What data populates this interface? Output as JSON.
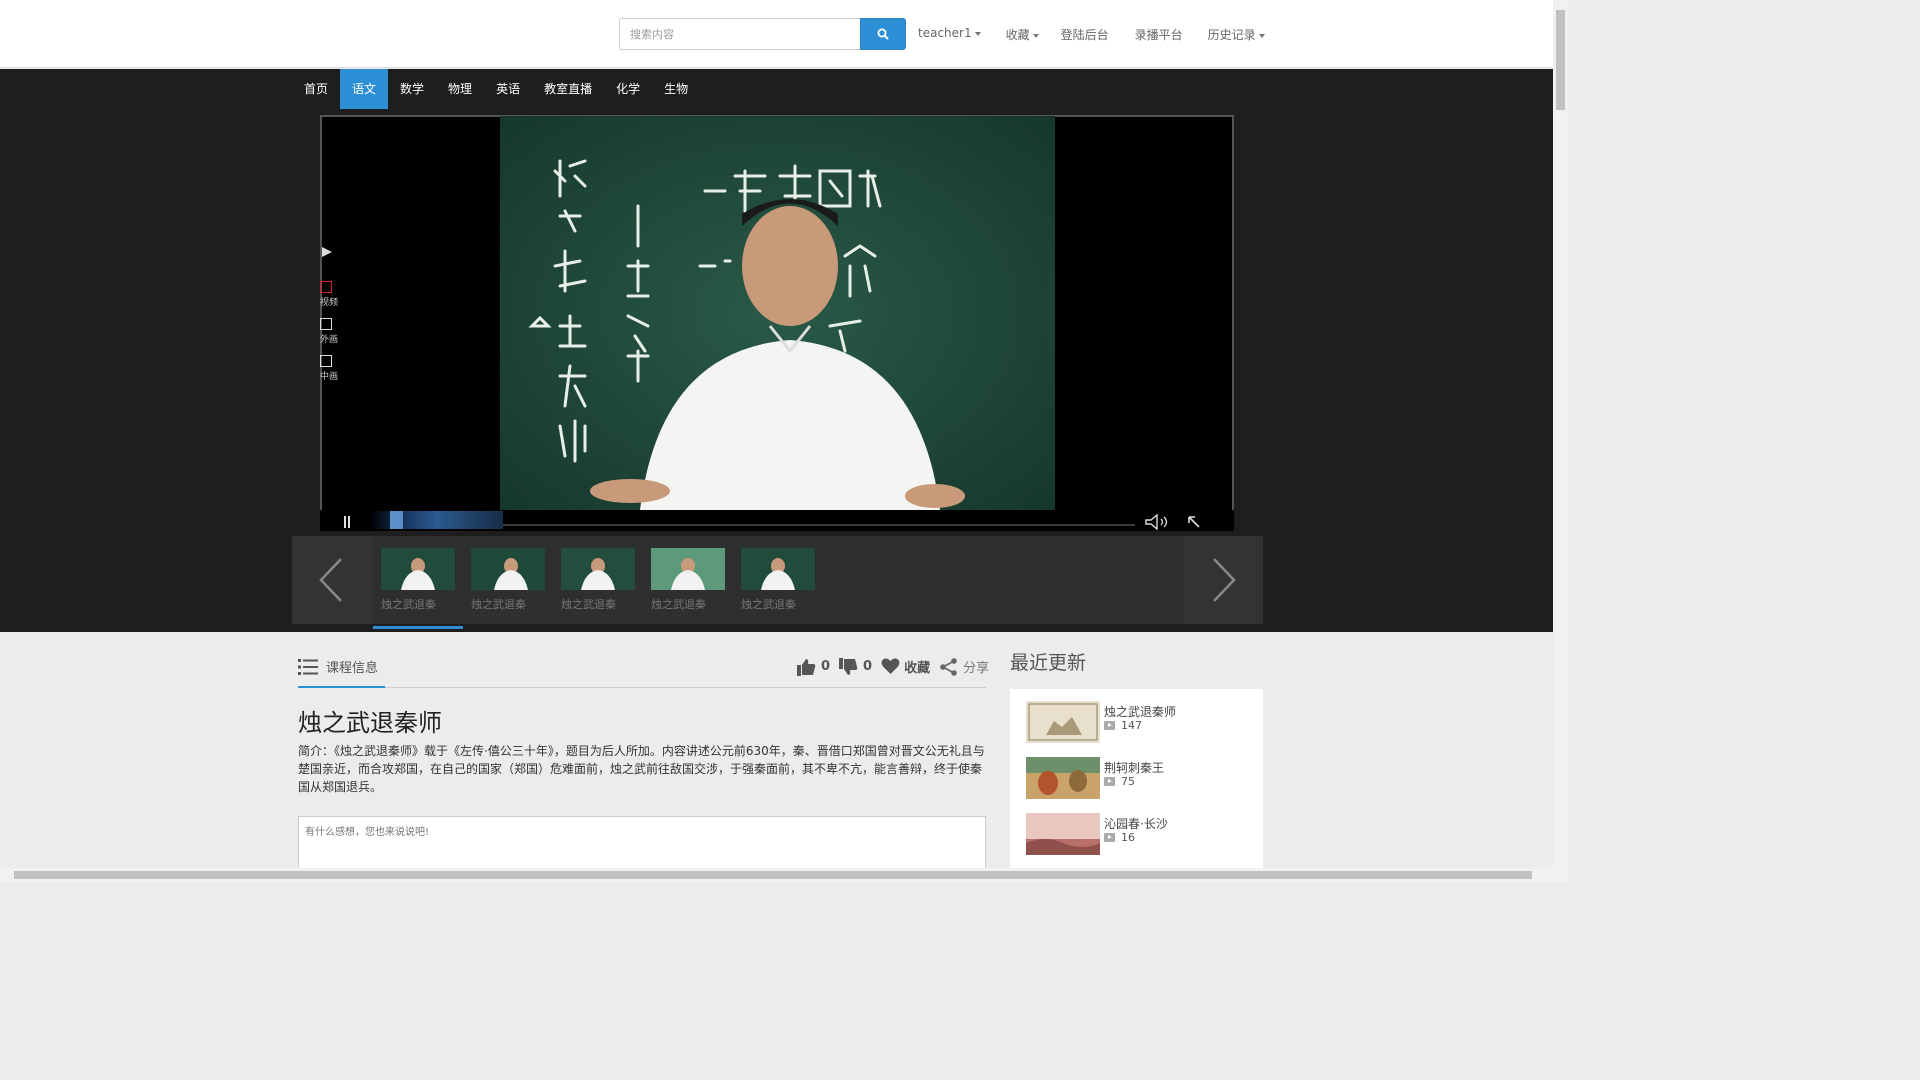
{
  "search": {
    "placeholder": "搜索内容"
  },
  "topnav": {
    "user": "teacher1",
    "favorites": "收藏",
    "admin": "登陆后台",
    "recording": "录播平台",
    "history": "历史记录"
  },
  "mainnav": [
    "首页",
    "语文",
    "数学",
    "物理",
    "英语",
    "教室直播",
    "化学",
    "生物"
  ],
  "mainnav_active": "语文",
  "player": {
    "side_tools": [
      "视频",
      "外画",
      "中画"
    ],
    "progress_fraction": 0.04
  },
  "playlist": [
    {
      "label": "烛之武退秦"
    },
    {
      "label": "烛之武退秦"
    },
    {
      "label": "烛之武退秦"
    },
    {
      "label": "烛之武退秦"
    },
    {
      "label": "烛之武退秦"
    }
  ],
  "course": {
    "tab": "课程信息",
    "likes": "0",
    "dislikes": "0",
    "favorite": "收藏",
    "share": "分享",
    "title": "烛之武退秦师",
    "desc": "简介：《烛之武退秦师》载于《左传·僖公三十年》，题目为后人所加。内容讲述公元前630年，秦、晋借口郑国曾对晋文公无礼且与楚国亲近，而合攻郑国，在自己的国家（郑国）危难面前，烛之武前往敌国交涉，于强秦面前，其不卑不亢，能言善辩，终于使秦国从郑国退兵。",
    "comment_placeholder": "有什么感想，您也来说说吧!"
  },
  "recent": {
    "title": "最近更新",
    "items": [
      {
        "name": "烛之武退秦师",
        "count": "147"
      },
      {
        "name": "荆轲刺秦王",
        "count": "75"
      },
      {
        "name": "沁园春·长沙",
        "count": "16"
      }
    ]
  },
  "colors": {
    "accent": "#2d8fd5",
    "dark": "#1e1e1e"
  }
}
